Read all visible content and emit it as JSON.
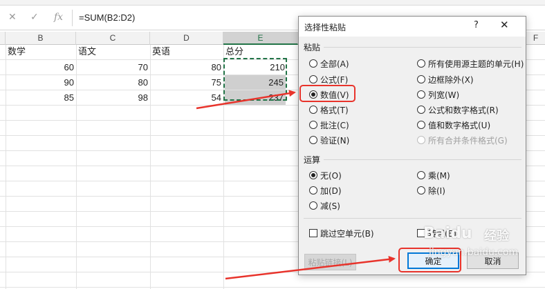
{
  "formula_bar": {
    "cancel_icon": "close-icon",
    "confirm_icon": "check-icon",
    "fx_label": "fx",
    "formula": "=SUM(B2:D2)"
  },
  "sheet": {
    "columns": [
      "B",
      "C",
      "D",
      "E",
      "F"
    ],
    "headers": [
      "数学",
      "语文",
      "英语",
      "总分"
    ],
    "rows": [
      [
        "60",
        "70",
        "80",
        "210"
      ],
      [
        "90",
        "80",
        "75",
        "245"
      ],
      [
        "85",
        "98",
        "54",
        "237"
      ]
    ]
  },
  "dialog": {
    "title": "选择性粘贴",
    "help": "?",
    "close": "✕",
    "paste_group": "粘贴",
    "paste_options": {
      "all": "全部(A)",
      "formulas": "公式(F)",
      "values": "数值(V)",
      "formats": "格式(T)",
      "comments": "批注(C)",
      "validation": "验证(N)",
      "source_theme": "所有使用源主题的单元(H)",
      "except_borders": "边框除外(X)",
      "column_widths": "列宽(W)",
      "formulas_numbers": "公式和数字格式(R)",
      "values_numbers": "值和数字格式(U)",
      "merge_conditional": "所有合并条件格式(G)"
    },
    "selected_paste": "values",
    "operation_group": "运算",
    "operation_options": {
      "none": "无(O)",
      "add": "加(D)",
      "subtract": "减(S)",
      "multiply": "乘(M)",
      "divide": "除(I)"
    },
    "selected_operation": "none",
    "skip_blanks": "跳过空单元(B)",
    "transpose": "转置(E)",
    "paste_link": "粘贴链接(L)",
    "ok": "确定",
    "cancel": "取消"
  },
  "watermark": {
    "brand": "Baidu",
    "sub": "经验",
    "url": "jingyan.baidu.com"
  },
  "colors": {
    "accent": "#217346",
    "annotation": "#e8332b",
    "focus": "#0078d7"
  }
}
